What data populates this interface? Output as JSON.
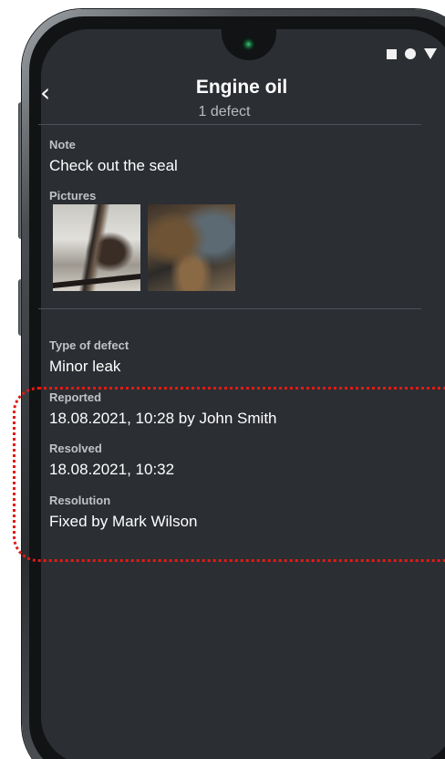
{
  "header": {
    "title": "Engine oil",
    "subtitle": "1 defect",
    "back_icon": "chevron-left-icon"
  },
  "status_bar": {
    "icons": [
      "square-icon",
      "circle-icon",
      "triangle-icon"
    ]
  },
  "note": {
    "label": "Note",
    "value": "Check out the seal"
  },
  "pictures": {
    "label": "Pictures",
    "items": [
      "engine-photo-1",
      "engine-photo-2"
    ]
  },
  "defect": {
    "type_label": "Type of defect",
    "type_value": "Minor leak",
    "reported_label": "Reported",
    "reported_value": "18.08.2021, 10:28 by John Smith",
    "resolved_label": "Resolved",
    "resolved_value": "18.08.2021, 10:32",
    "resolution_label": "Resolution",
    "resolution_value": "Fixed by Mark Wilson"
  },
  "colors": {
    "screen_bg": "#2b2e33",
    "highlight": "#e11b14"
  }
}
